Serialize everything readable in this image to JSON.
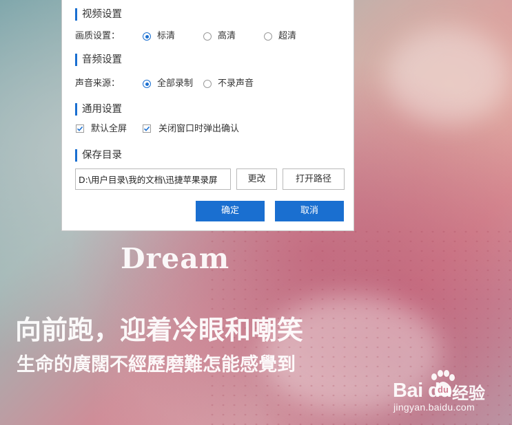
{
  "dialog": {
    "video": {
      "title": "视频设置",
      "quality_label": "画质设置：",
      "options": [
        "标清",
        "高清",
        "超清"
      ],
      "selected": "标清"
    },
    "audio": {
      "title": "音频设置",
      "source_label": "声音来源：",
      "options": [
        "全部录制",
        "不录声音"
      ],
      "selected": "全部录制"
    },
    "general": {
      "title": "通用设置",
      "checkboxes": [
        {
          "label": "默认全屏",
          "checked": true
        },
        {
          "label": "关闭窗口时弹出确认",
          "checked": true
        }
      ]
    },
    "save_dir": {
      "title": "保存目录",
      "path_value": "D:\\用户目录\\我的文档\\迅捷苹果录屏",
      "change_label": "更改",
      "open_path_label": "打开路径"
    },
    "ok_label": "确定",
    "cancel_label": "取消",
    "accent_color": "#1a6fd0"
  },
  "background": {
    "dream_text": "Dream",
    "line1": "向前跑，迎着冷眼和嘲笑",
    "line2": "生命的廣闊不經歷磨難怎能感覺到"
  },
  "watermark": {
    "brand": "Bai  du",
    "brand_cn": "经验",
    "url": "jingyan.baidu.com"
  }
}
